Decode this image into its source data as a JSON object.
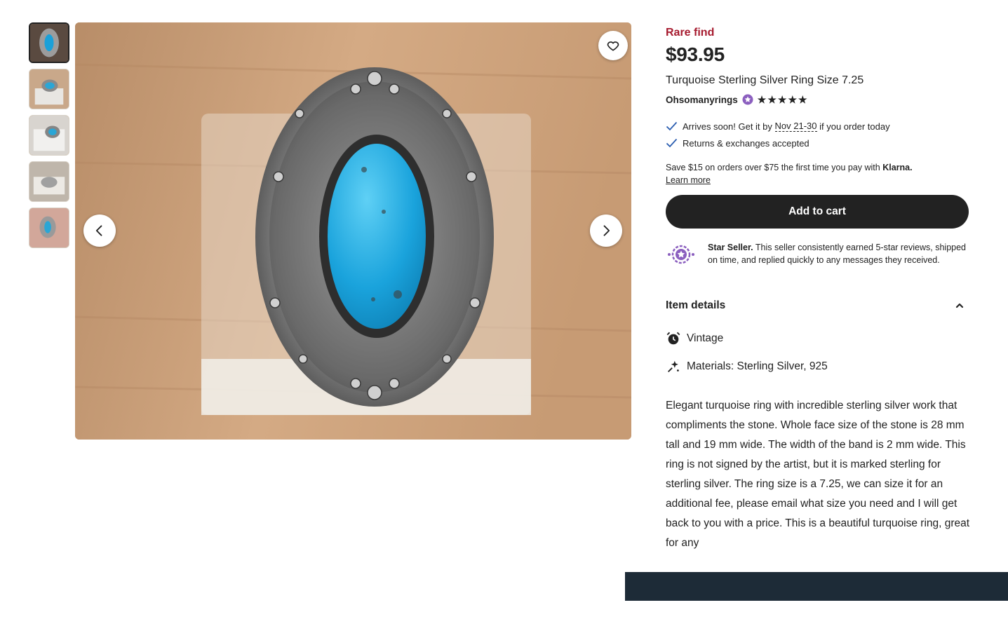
{
  "gallery": {
    "thumbnail_count": 5,
    "favorite_icon": "heart-outline-icon",
    "prev_icon": "chevron-left-icon",
    "next_icon": "chevron-right-icon"
  },
  "listing": {
    "badge": "Rare find",
    "price": "$93.95",
    "title": "Turquoise Sterling Silver Ring Size 7.25",
    "seller": "Ohsomanyrings",
    "rating_stars": 5,
    "shipping_prefix": "Arrives soon! Get it by",
    "shipping_dates": "Nov 21-30",
    "shipping_suffix": "if you order today",
    "returns": "Returns & exchanges accepted",
    "klarna_text": "Save $15 on orders over $75 the first time you pay with",
    "klarna_brand": "Klarna.",
    "learn_more": "Learn more",
    "add_to_cart": "Add to cart",
    "star_seller_title": "Star Seller.",
    "star_seller_text": "This seller consistently earned 5-star reviews, shipped on time, and replied quickly to any messages they received.",
    "details_heading": "Item details",
    "detail_vintage": "Vintage",
    "detail_materials": "Materials: Sterling Silver, 925",
    "description": "Elegant turquoise ring with incredible sterling silver work that compliments the stone. Whole face size of the stone is 28 mm tall and 19 mm wide. The width of the band is 2 mm wide. This ring is not signed by the artist, but it is marked sterling for sterling silver. The ring size is a 7.25, we can size it for an additional fee, please email what size you need and I will get back to you with a price. This is a beautiful turquoise ring, great for any"
  },
  "colors": {
    "rare_find": "#a61a2e",
    "button": "#222222",
    "star_seller_purple": "#8b5fbf",
    "bottom_bar": "#1d2b37"
  }
}
